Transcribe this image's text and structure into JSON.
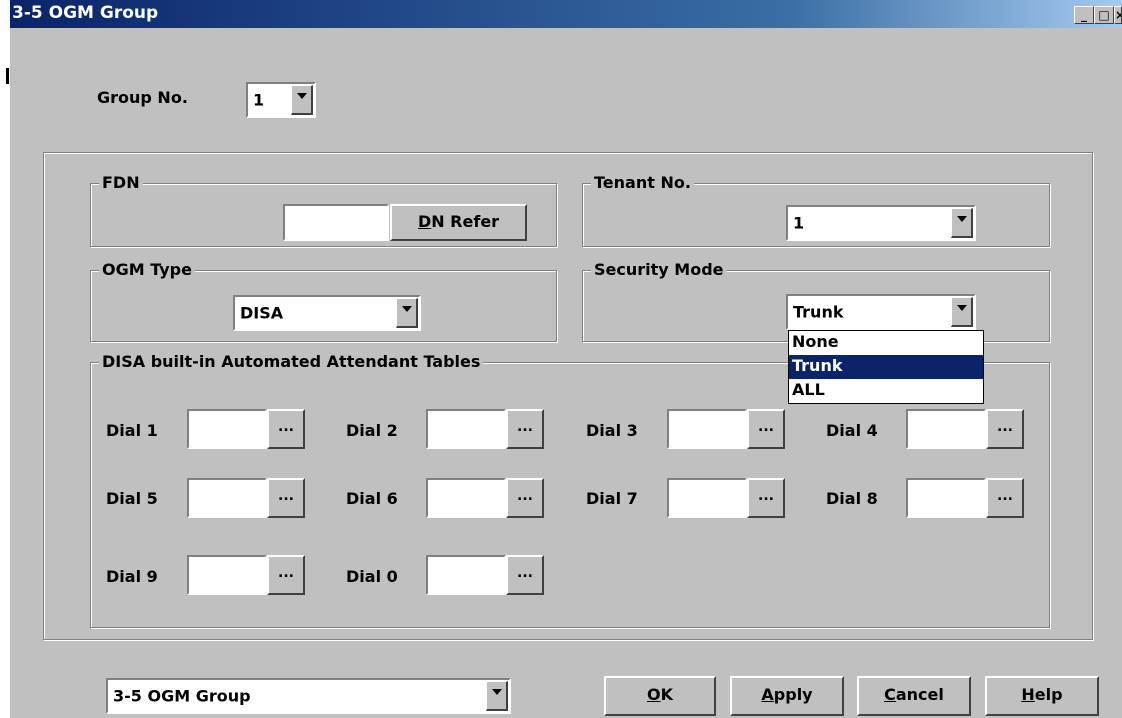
{
  "window": {
    "title": "3-5 OGM Group"
  },
  "group_no": {
    "label": "Group No.",
    "value": "1"
  },
  "fdn": {
    "legend": "FDN",
    "value": "",
    "button_rest": "N Refer",
    "button_key": "D"
  },
  "tenant": {
    "legend": "Tenant No.",
    "value": "1"
  },
  "ogm_type": {
    "legend": "OGM Type",
    "value": "DISA"
  },
  "security": {
    "legend": "Security Mode",
    "value": "Trunk",
    "options": [
      "None",
      "Trunk",
      "ALL"
    ],
    "selected": "Trunk"
  },
  "disa": {
    "legend": "DISA built-in Automated Attendant Tables",
    "ellipsis": "...",
    "dials": [
      {
        "label": "Dial 1",
        "value": ""
      },
      {
        "label": "Dial 2",
        "value": ""
      },
      {
        "label": "Dial 3",
        "value": ""
      },
      {
        "label": "Dial 4",
        "value": ""
      },
      {
        "label": "Dial 5",
        "value": ""
      },
      {
        "label": "Dial 6",
        "value": ""
      },
      {
        "label": "Dial 7",
        "value": ""
      },
      {
        "label": "Dial 8",
        "value": ""
      },
      {
        "label": "Dial 9",
        "value": ""
      },
      {
        "label": "Dial 0",
        "value": ""
      }
    ]
  },
  "footer": {
    "page_select": "3-5 OGM Group",
    "ok": {
      "key": "O",
      "rest": "K"
    },
    "apply": {
      "key": "A",
      "rest": "pply"
    },
    "cancel": {
      "key": "C",
      "rest": "ancel"
    },
    "help": {
      "key": "H",
      "rest": "elp"
    }
  }
}
